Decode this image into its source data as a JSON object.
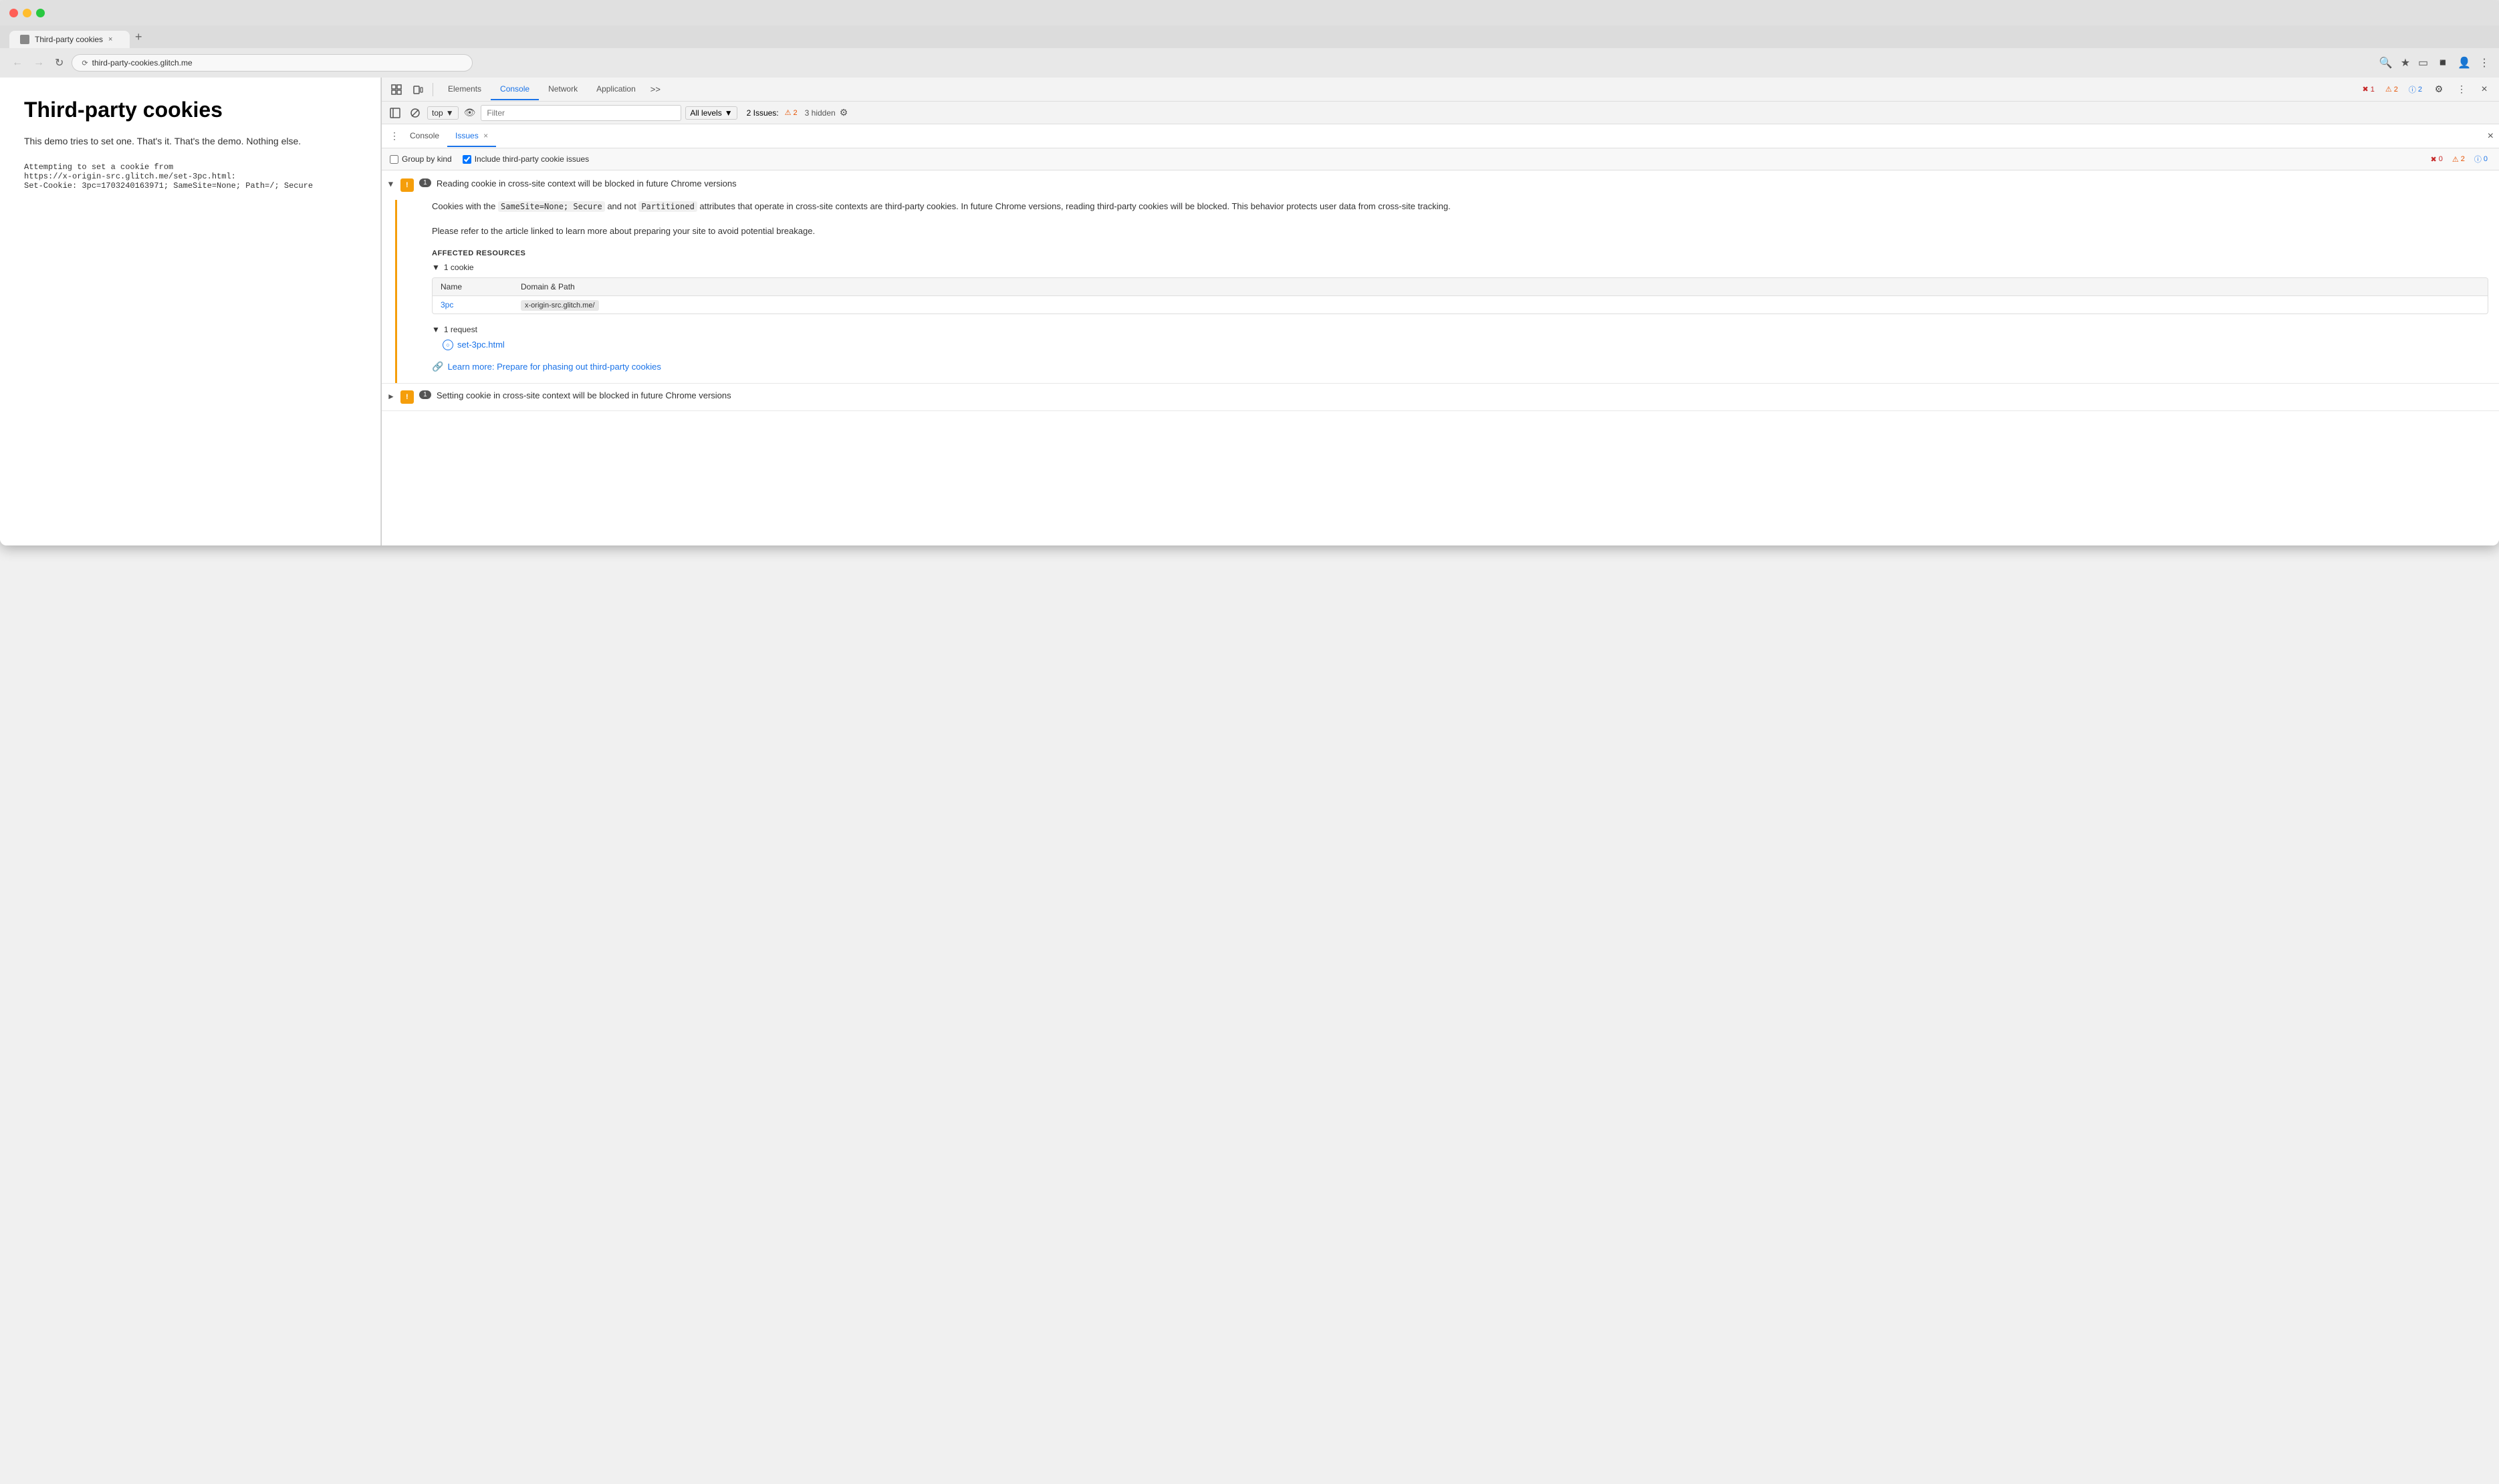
{
  "browser": {
    "tab_title": "Third-party cookies",
    "url": "third-party-cookies.glitch.me",
    "tab_close": "×",
    "tab_new": "+"
  },
  "page": {
    "title": "Third-party cookies",
    "description": "This demo tries to set one. That's it. That's the demo. Nothing else.",
    "attempting_label": "Attempting to set a cookie from",
    "cookie_url": "https://x-origin-src.glitch.me/set-3pc.html:",
    "cookie_value": "Set-Cookie: 3pc=1703240163971; SameSite=None; Path=/; Secure"
  },
  "devtools": {
    "tabs": [
      "Elements",
      "Console",
      "Network",
      "Application"
    ],
    "active_tab": "Console",
    "more_label": ">>",
    "error_count": "1",
    "warning_count": "2",
    "info_count": "2",
    "context_label": "top",
    "filter_placeholder": "Filter",
    "levels_label": "All levels",
    "issues_summary_label": "2 Issues:",
    "issues_badge": "2",
    "hidden_label": "3 hidden",
    "close_label": "×"
  },
  "issues_panel": {
    "console_tab": "Console",
    "issues_tab": "Issues",
    "close_tab_label": "×",
    "group_by_kind_label": "Group by kind",
    "include_third_party_label": "Include third-party cookie issues",
    "error_badge": "0",
    "warning_badge": "2",
    "info_badge": "0",
    "issues": [
      {
        "id": "issue-1",
        "count": "1",
        "title": "Reading cookie in cross-site context will be blocked in future Chrome versions",
        "expanded": true,
        "description_parts": [
          "Cookies with the ",
          "SameSite=None; Secure",
          " and not ",
          "Partitioned",
          " attributes that operate in cross-site contexts are third-party cookies. In future Chrome versions, reading third-party cookies will be blocked. This behavior protects user data from cross-site tracking."
        ],
        "description2": "Please refer to the article linked to learn more about preparing your site to avoid potential breakage.",
        "affected_resources_label": "AFFECTED RESOURCES",
        "cookie_group_label": "1 cookie",
        "table_col_name": "Name",
        "table_col_domain": "Domain & Path",
        "cookie_name": "3pc",
        "cookie_domain": "x-origin-src.glitch.me/",
        "request_group_label": "1 request",
        "request_link": "set-3pc.html",
        "learn_more_label": "Learn more: Prepare for phasing out third-party cookies"
      },
      {
        "id": "issue-2",
        "count": "1",
        "title": "Setting cookie in cross-site context will be blocked in future Chrome versions",
        "expanded": false
      }
    ]
  }
}
